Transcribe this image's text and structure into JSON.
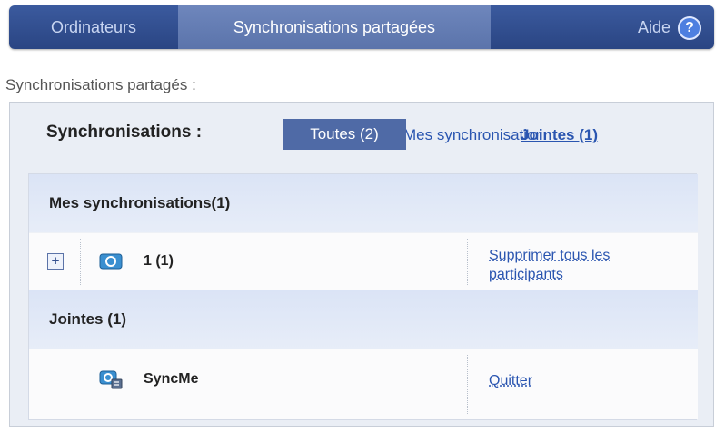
{
  "nav": {
    "tabs": [
      {
        "label": "Ordinateurs"
      },
      {
        "label": "Synchronisations partagées"
      }
    ],
    "help_label": "Aide",
    "help_glyph": "?"
  },
  "section_label": "Synchronisations partagés :",
  "filter": {
    "title": "Synchronisations :",
    "all_label": "Toutes (2)",
    "mine_label": "Mes synchronisations",
    "joined_label": "Jointes (1)"
  },
  "groups": {
    "mine": {
      "header": "Mes synchronisations(1)",
      "rows": [
        {
          "name": "1 (1)",
          "icon": "shared-sync-icon",
          "action": "Supprimer tous les participants",
          "expand_glyph": "+"
        }
      ]
    },
    "joined": {
      "header": "Jointes (1)",
      "rows": [
        {
          "name": "SyncMe",
          "icon": "joined-sync-icon",
          "action": "Quitter"
        }
      ]
    }
  },
  "colors": {
    "nav_bg": "#2a4583",
    "nav_active": "#5b74ab",
    "link": "#2a55b0",
    "group_header": "#dbe4f6",
    "panel": "#eaeef5"
  }
}
